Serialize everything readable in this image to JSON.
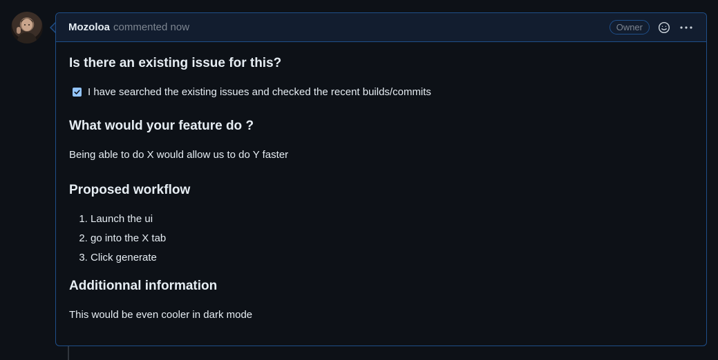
{
  "comment": {
    "author": "Mozoloa",
    "meta": "commented now",
    "badge": "Owner"
  },
  "icons": {
    "avatar": "user-avatar",
    "emoji": "smiley-icon",
    "more": "kebab-horizontal-icon",
    "checkbox": "checkbox-checked-icon"
  },
  "body": {
    "heading_issue": "Is there an existing issue for this?",
    "checkbox_label": "I have searched the existing issues and checked the recent builds/commits",
    "heading_feature": "What would your feature do ?",
    "feature_text": "Being able to do X would allow us to do Y faster",
    "heading_workflow": "Proposed workflow",
    "workflow_steps": [
      "Launch the ui",
      "go into the X tab",
      "Click generate"
    ],
    "heading_additional": "Additionnal information",
    "additional_text": "This would be even cooler in dark mode"
  },
  "colors": {
    "background": "#0d1117",
    "header_bg": "#121d2f",
    "border": "#1f4f8a",
    "text": "#e6edf3",
    "muted": "#7d8590",
    "checkbox": "#93c5fd"
  }
}
